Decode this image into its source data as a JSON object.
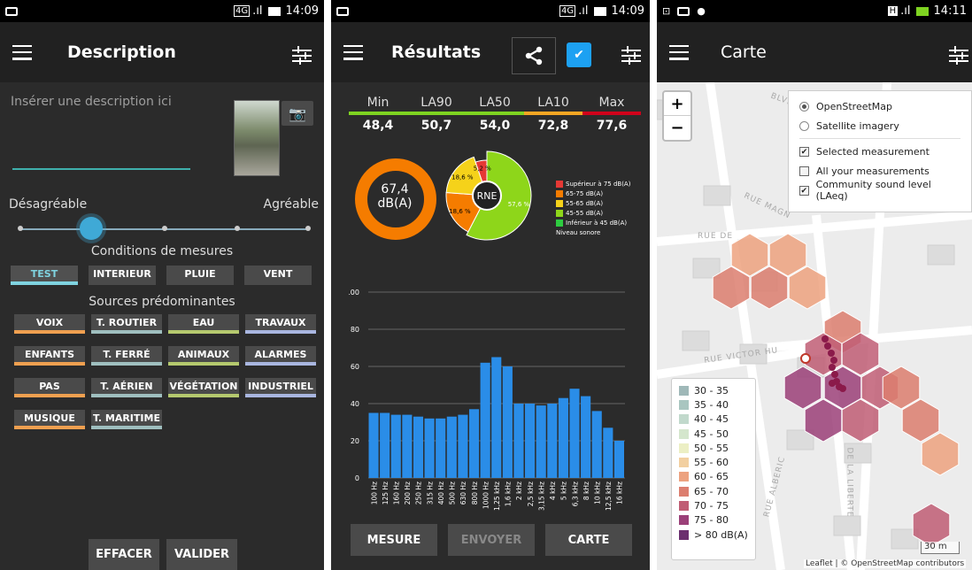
{
  "panel1": {
    "status": {
      "network": "4G",
      "time": "14:09"
    },
    "title": "Description",
    "description_placeholder": "Insérer une description ici",
    "slider": {
      "left_label": "Désagréable",
      "right_label": "Agréable",
      "value_fraction": 0.25
    },
    "conditions_title": "Conditions de mesures",
    "conditions": [
      "TEST",
      "INTERIEUR",
      "PLUIE",
      "VENT"
    ],
    "sources_title": "Sources prédominantes",
    "sources": [
      {
        "label": "VOIX",
        "color": "#f0a050"
      },
      {
        "label": "T. ROUTIER",
        "color": "#9fbfbf"
      },
      {
        "label": "EAU",
        "color": "#b5c96e"
      },
      {
        "label": "TRAVAUX",
        "color": "#a9b6e0"
      },
      {
        "label": "ENFANTS",
        "color": "#f0a050"
      },
      {
        "label": "T. FERRÉ",
        "color": "#9fbfbf"
      },
      {
        "label": "ANIMAUX",
        "color": "#b5c96e"
      },
      {
        "label": "ALARMES",
        "color": "#a9b6e0"
      },
      {
        "label": "PAS",
        "color": "#f0a050"
      },
      {
        "label": "T. AÉRIEN",
        "color": "#9fbfbf"
      },
      {
        "label": "VÉGÉTATION",
        "color": "#b5c96e"
      },
      {
        "label": "INDUSTRIEL",
        "color": "#a9b6e0"
      },
      {
        "label": "MUSIQUE",
        "color": "#f0a050"
      },
      {
        "label": "T. MARITIME",
        "color": "#9fbfbf"
      }
    ],
    "buttons": {
      "clear": "EFFACER",
      "validate": "VALIDER"
    }
  },
  "panel2": {
    "status": {
      "network": "4G",
      "time": "14:09"
    },
    "title": "Résultats",
    "stats": [
      {
        "label": "Min",
        "value": "48,4"
      },
      {
        "label": "LA90",
        "value": "50,7"
      },
      {
        "label": "LA50",
        "value": "54,0"
      },
      {
        "label": "LA10",
        "value": "72,8"
      },
      {
        "label": "Max",
        "value": "77,6"
      }
    ],
    "stat_bar_colors": [
      "#7ed321",
      "#7ed321",
      "#7ed321",
      "#f5a623",
      "#d0021b"
    ],
    "gauge": {
      "value": "67,4",
      "unit": "dB(A)",
      "color": "#f57c00"
    },
    "rne": {
      "center_label": "RNE",
      "slices": [
        {
          "label": "57,6 %",
          "percent": 57.6,
          "color": "#8ed61a"
        },
        {
          "label": "18,6 %",
          "percent": 18.6,
          "color": "#f57c00"
        },
        {
          "label": "18,6 %",
          "percent": 18.6,
          "color": "#f5d21a"
        },
        {
          "label": "5,2 %",
          "percent": 5.2,
          "color": "#e53935"
        }
      ]
    },
    "rne_legend": [
      {
        "label": "Supérieur à 75 dB(A)",
        "color": "#e53935"
      },
      {
        "label": "65-75 dB(A)",
        "color": "#f57c00"
      },
      {
        "label": "55-65 dB(A)",
        "color": "#f5d21a"
      },
      {
        "label": "45-55 dB(A)",
        "color": "#8ed61a"
      },
      {
        "label": "Inférieur à 45 dB(A)",
        "color": "#2ecc40"
      }
    ],
    "rne_legend_caption": "Niveau sonore",
    "buttons": {
      "measure": "MESURE",
      "send": "ENVOYER",
      "map": "CARTE"
    }
  },
  "chart_data": {
    "type": "bar",
    "categories": [
      "100 Hz",
      "125 Hz",
      "160 Hz",
      "200 Hz",
      "250 Hz",
      "315 Hz",
      "400 Hz",
      "500 Hz",
      "630 Hz",
      "800 Hz",
      "1000 Hz",
      "1,25 kHz",
      "1,6 kHz",
      "2 kHz",
      "2,5 kHz",
      "3,15 kHz",
      "4 kHz",
      "5 kHz",
      "6,3 kHz",
      "8 kHz",
      "10 kHz",
      "12,5 kHz",
      "16 kHz"
    ],
    "values": [
      35,
      35,
      34,
      34,
      33,
      32,
      32,
      33,
      34,
      37,
      62,
      65,
      60,
      40,
      40,
      39,
      40,
      43,
      48,
      44,
      36,
      27,
      20
    ],
    "ylim": [
      0,
      100
    ],
    "yticks": [
      0,
      20,
      40,
      60,
      80,
      100
    ],
    "grid": true,
    "color": "#2a8de8"
  },
  "panel3": {
    "status": {
      "time": "14:11"
    },
    "title": "Carte",
    "zoom": {
      "in": "+",
      "out": "−"
    },
    "base_layers": [
      {
        "label": "OpenStreetMap",
        "selected": true
      },
      {
        "label": "Satellite imagery",
        "selected": false
      }
    ],
    "overlays": [
      {
        "label": "Selected measurement",
        "checked": true
      },
      {
        "label": "All your measurements",
        "checked": false
      },
      {
        "label": "Community sound level (LAeq)",
        "checked": true
      }
    ],
    "legend": [
      {
        "label": "30 - 35",
        "color": "#9fb8b8"
      },
      {
        "label": "35 - 40",
        "color": "#a9c6c0"
      },
      {
        "label": "40 - 45",
        "color": "#c1d9cc"
      },
      {
        "label": "45 - 50",
        "color": "#d4e6cc"
      },
      {
        "label": "50 - 55",
        "color": "#ecefc4"
      },
      {
        "label": "55 - 60",
        "color": "#f2cfa0"
      },
      {
        "label": "60 - 65",
        "color": "#eda27f"
      },
      {
        "label": "65 - 70",
        "color": "#dc7e6f"
      },
      {
        "label": "70 - 75",
        "color": "#c05d74"
      },
      {
        "label": "75 - 80",
        "color": "#9b3f78"
      },
      {
        "label": "> 80 dB(A)",
        "color": "#6b2f6f"
      }
    ],
    "streets": [
      "BLVD",
      "RUE MAGN",
      "RUE DE",
      "RUE VICTOR HU",
      "RUE ALBERIC",
      "DE LA LIBERTE"
    ],
    "scale": "30 m",
    "attribution": "Leaflet | © OpenStreetMap contributors"
  }
}
